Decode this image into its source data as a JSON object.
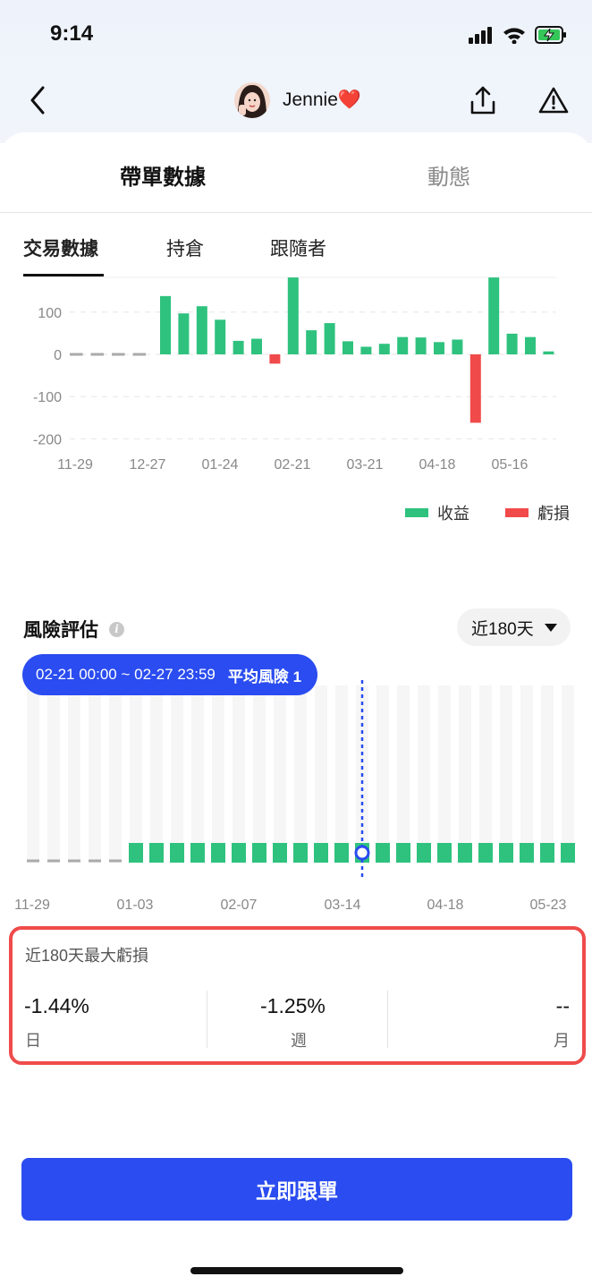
{
  "status_bar": {
    "time": "9:14"
  },
  "nav": {
    "profile_name": "Jennie",
    "heart": "❤️",
    "icons": {
      "back": "chevron-left-icon",
      "share": "share-icon",
      "report": "warning-icon"
    }
  },
  "main_tabs": [
    {
      "label": "帶單數據",
      "active": true
    },
    {
      "label": "動態",
      "active": false
    }
  ],
  "sub_tabs": [
    {
      "label": "交易數據",
      "active": true
    },
    {
      "label": "持倉",
      "active": false
    },
    {
      "label": "跟隨者",
      "active": false
    }
  ],
  "chart_data": [
    {
      "type": "bar",
      "x_ticks": [
        "11-29",
        "12-27",
        "01-24",
        "02-21",
        "03-21",
        "04-18",
        "05-16"
      ],
      "y_ticks": [
        "100",
        "0",
        "-100",
        "-200"
      ],
      "ylim": [
        -200,
        180
      ],
      "grid": true,
      "legend_position": "bottom-right",
      "colors": {
        "profit": "#2ec27e",
        "loss": "#f04a4a",
        "empty": "#aaaaaa"
      },
      "no_data_count": 4,
      "values": [
        138,
        97,
        114,
        82,
        32,
        37,
        -22,
        182,
        57,
        74,
        31,
        18,
        25,
        41,
        40,
        29,
        35,
        -162,
        182,
        49,
        41,
        7
      ],
      "series": [
        {
          "name": "收益",
          "color": "#2ec27e"
        },
        {
          "name": "虧損",
          "color": "#f04a4a"
        }
      ]
    },
    {
      "type": "bar",
      "x_ticks": [
        "11-29",
        "01-03",
        "02-07",
        "03-14",
        "04-18",
        "05-23"
      ],
      "total_weeks": 27,
      "no_data_count": 5,
      "risk_levels": [
        1,
        1,
        1,
        1,
        1,
        1,
        1,
        1,
        1,
        1,
        1,
        1,
        1,
        1,
        1,
        1,
        1,
        1,
        1,
        1,
        1,
        1
      ],
      "selected_index": 11,
      "colors": {
        "bar": "#2ec27e",
        "track": "#f6f6f6",
        "marker": "#2a4cf0"
      }
    }
  ],
  "risk": {
    "title": "風險評估",
    "period": "近180天",
    "tooltip_range": "02-21 00:00 ~ 02-27 23:59",
    "tooltip_value": "平均風險 1"
  },
  "drawdown": {
    "title": "近180天最大虧損",
    "items": [
      {
        "value": "-1.44%",
        "label": "日"
      },
      {
        "value": "-1.25%",
        "label": "週"
      },
      {
        "value": "--",
        "label": "月"
      }
    ]
  },
  "follow_button": "立即跟單"
}
